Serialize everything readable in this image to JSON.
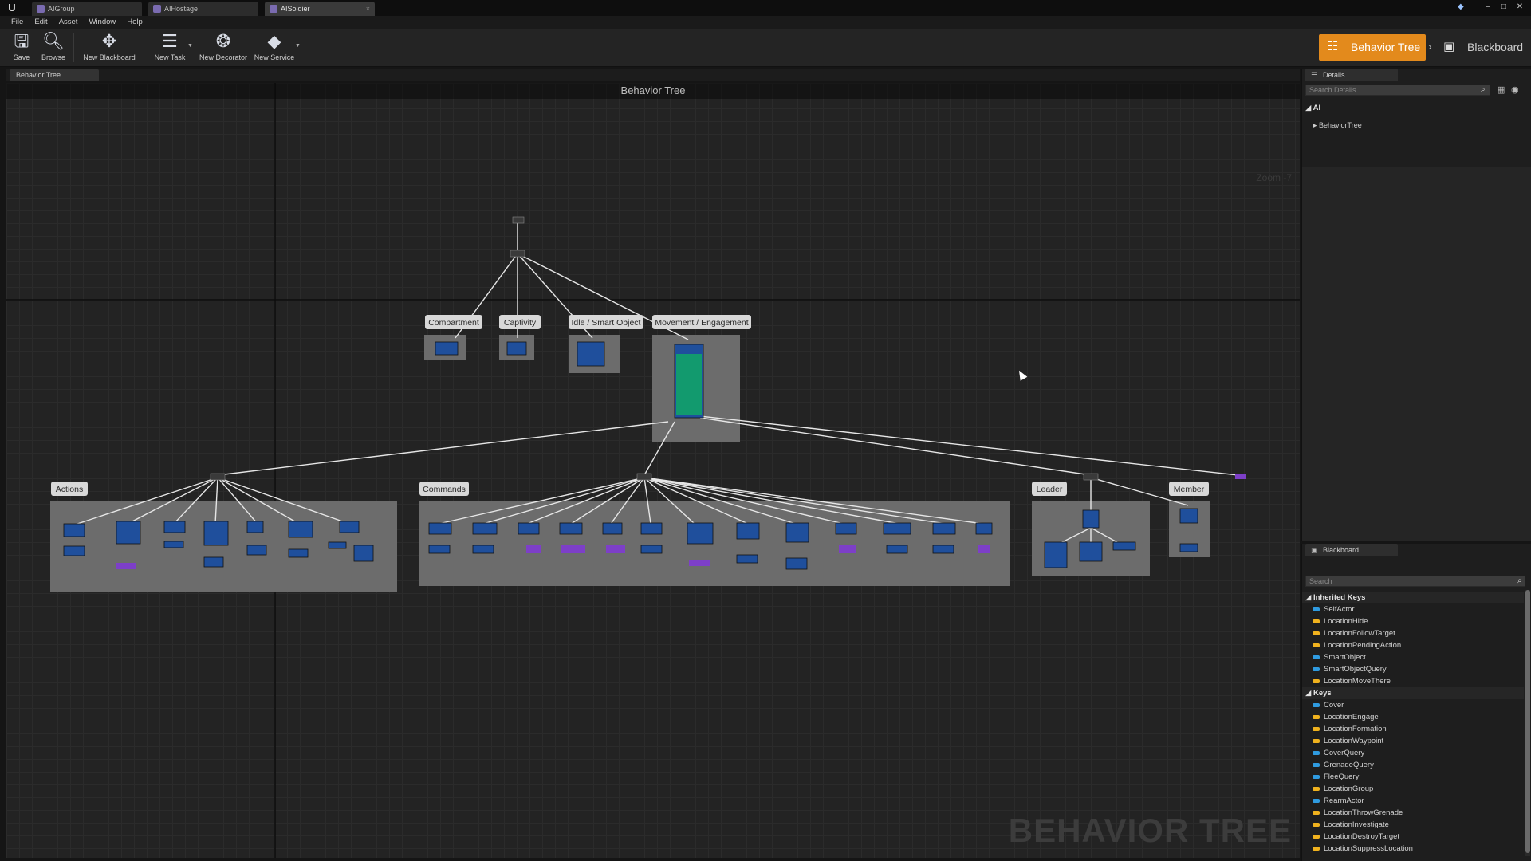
{
  "titlebar": {
    "tabs": [
      {
        "label": "AIGroup"
      },
      {
        "label": "AIHostage"
      },
      {
        "label": "AISoldier"
      }
    ]
  },
  "menu": [
    "File",
    "Edit",
    "Asset",
    "Window",
    "Help"
  ],
  "toolbar": {
    "save": "Save",
    "browse": "Browse",
    "new_blackboard": "New Blackboard",
    "new_task": "New Task",
    "new_decorator": "New Decorator",
    "new_service": "New Service"
  },
  "modes": {
    "behavior_tree": "Behavior Tree",
    "blackboard": "Blackboard"
  },
  "graph": {
    "tab_label": "Behavior Tree",
    "header_title": "Behavior Tree",
    "zoom": "Zoom -7",
    "watermark": "BEHAVIOR TREE",
    "comments": [
      "Compartment",
      "Captivity",
      "Idle / Smart Object",
      "Movement / Engagement",
      "Actions",
      "Commands",
      "Leader",
      "Member"
    ]
  },
  "details": {
    "tab_label": "Details",
    "search_placeholder": "Search Details",
    "category": "AI",
    "property": "BehaviorTree"
  },
  "blackboard": {
    "tab_label": "Blackboard",
    "search_placeholder": "Search",
    "inherited_label": "Inherited Keys",
    "inherited_keys": [
      {
        "name": "SelfActor",
        "color": "#2f9be0"
      },
      {
        "name": "LocationHide",
        "color": "#f0b21e"
      },
      {
        "name": "LocationFollowTarget",
        "color": "#f0b21e"
      },
      {
        "name": "LocationPendingAction",
        "color": "#f0b21e"
      },
      {
        "name": "SmartObject",
        "color": "#2f9be0"
      },
      {
        "name": "SmartObjectQuery",
        "color": "#2f9be0"
      },
      {
        "name": "LocationMoveThere",
        "color": "#f0b21e"
      }
    ],
    "keys_label": "Keys",
    "keys": [
      {
        "name": "Cover",
        "color": "#2f9be0"
      },
      {
        "name": "LocationEngage",
        "color": "#f0b21e"
      },
      {
        "name": "LocationFormation",
        "color": "#f0b21e"
      },
      {
        "name": "LocationWaypoint",
        "color": "#f0b21e"
      },
      {
        "name": "CoverQuery",
        "color": "#2f9be0"
      },
      {
        "name": "GrenadeQuery",
        "color": "#2f9be0"
      },
      {
        "name": "FleeQuery",
        "color": "#2f9be0"
      },
      {
        "name": "LocationGroup",
        "color": "#f0b21e"
      },
      {
        "name": "RearmActor",
        "color": "#2f9be0"
      },
      {
        "name": "LocationThrowGrenade",
        "color": "#f0b21e"
      },
      {
        "name": "LocationInvestigate",
        "color": "#f0b21e"
      },
      {
        "name": "LocationDestroyTarget",
        "color": "#f0b21e"
      },
      {
        "name": "LocationSuppressLocation",
        "color": "#f0b21e"
      }
    ]
  }
}
